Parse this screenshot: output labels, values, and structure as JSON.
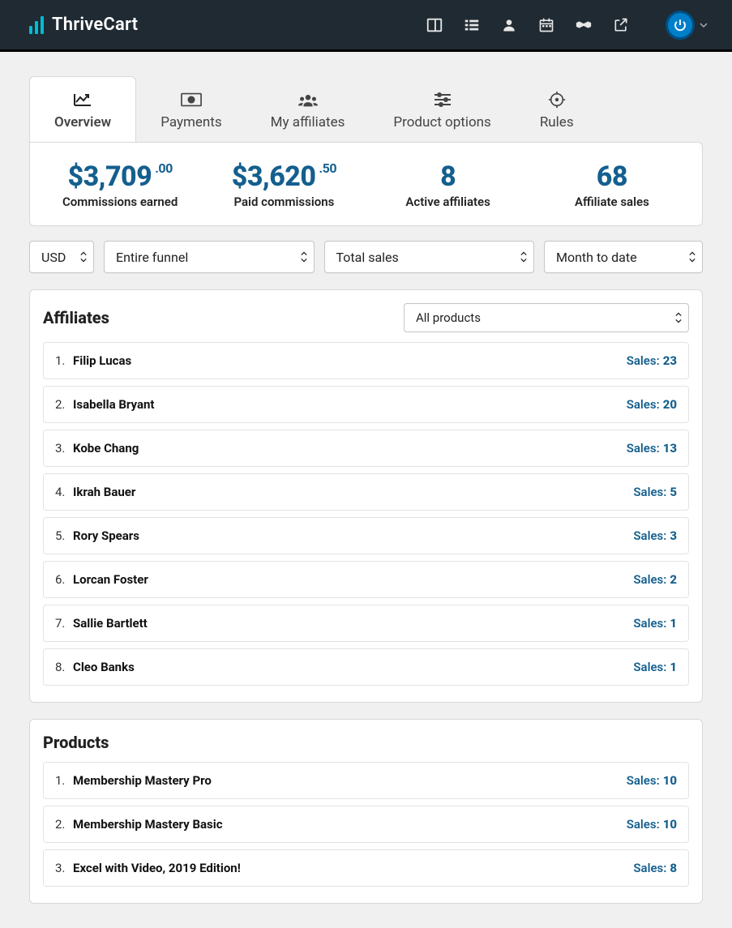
{
  "brand": {
    "name": "ThriveCart"
  },
  "tabs": {
    "overview": "Overview",
    "payments": "Payments",
    "my_affiliates": "My affiliates",
    "product_options": "Product options",
    "rules": "Rules"
  },
  "stats": {
    "commissions_earned": {
      "main": "$3,709",
      "cents": ".00",
      "label": "Commissions earned"
    },
    "paid_commissions": {
      "main": "$3,620",
      "cents": ".50",
      "label": "Paid commissions"
    },
    "active_affiliates": {
      "main": "8",
      "label": "Active affiliates"
    },
    "affiliate_sales": {
      "main": "68",
      "label": "Affiliate sales"
    }
  },
  "filters": {
    "currency": "USD",
    "funnel": "Entire funnel",
    "metric": "Total sales",
    "range": "Month to date"
  },
  "affiliates_panel": {
    "title": "Affiliates",
    "product_filter": "All products",
    "sales_label": "Sales:",
    "items": [
      {
        "idx": "1.",
        "name": "Filip Lucas",
        "sales": "23"
      },
      {
        "idx": "2.",
        "name": "Isabella Bryant",
        "sales": "20"
      },
      {
        "idx": "3.",
        "name": "Kobe Chang",
        "sales": "13"
      },
      {
        "idx": "4.",
        "name": "Ikrah Bauer",
        "sales": "5"
      },
      {
        "idx": "5.",
        "name": "Rory Spears",
        "sales": "3"
      },
      {
        "idx": "6.",
        "name": "Lorcan Foster",
        "sales": "2"
      },
      {
        "idx": "7.",
        "name": "Sallie Bartlett",
        "sales": "1"
      },
      {
        "idx": "8.",
        "name": "Cleo Banks",
        "sales": "1"
      }
    ]
  },
  "products_panel": {
    "title": "Products",
    "sales_label": "Sales:",
    "items": [
      {
        "idx": "1.",
        "name": "Membership Mastery Pro",
        "sales": "10"
      },
      {
        "idx": "2.",
        "name": "Membership Mastery Basic",
        "sales": "10"
      },
      {
        "idx": "3.",
        "name": "Excel with Video, 2019 Edition!",
        "sales": "8"
      }
    ]
  }
}
